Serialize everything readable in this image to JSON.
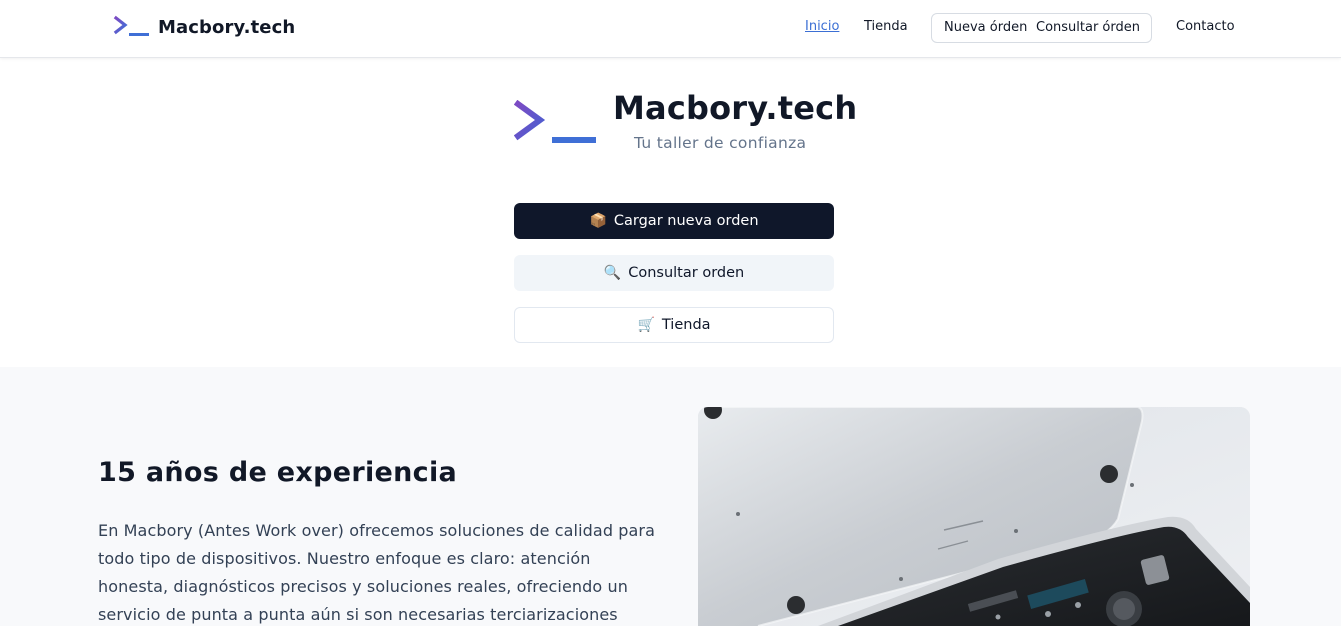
{
  "nav": {
    "brand": "Macbory.tech",
    "links": {
      "inicio": "Inicio",
      "tienda": "Tienda",
      "nueva_orden": "Nueva órden",
      "consultar_orden": "Consultar órden",
      "contacto": "Contacto"
    }
  },
  "hero": {
    "title": "Macbory.tech",
    "subtitle": "Tu taller de confianza",
    "buttons": {
      "primary": {
        "icon": "📦",
        "label": "Cargar nueva orden"
      },
      "secondary": {
        "icon": "🔍",
        "label": "Consultar orden"
      },
      "outline": {
        "icon": "🛒",
        "label": "Tienda"
      }
    }
  },
  "about": {
    "title": "15 años de experiencia",
    "text": "En Macbory (Antes Work over) ofrecemos soluciones de calidad para todo tipo de dispositivos. Nuestro enfoque es claro: atención honesta, diagnósticos precisos y soluciones reales, ofreciendo un servicio de punta a punta aún si son necesarias terciarizaciones",
    "image_icon": "macbook-open-photo"
  },
  "colors": {
    "accent": "#3b6fd4",
    "logo_chevron": "#6a4fc7",
    "logo_bar": "#3f6fd6",
    "primary_button": "#0f172a"
  }
}
